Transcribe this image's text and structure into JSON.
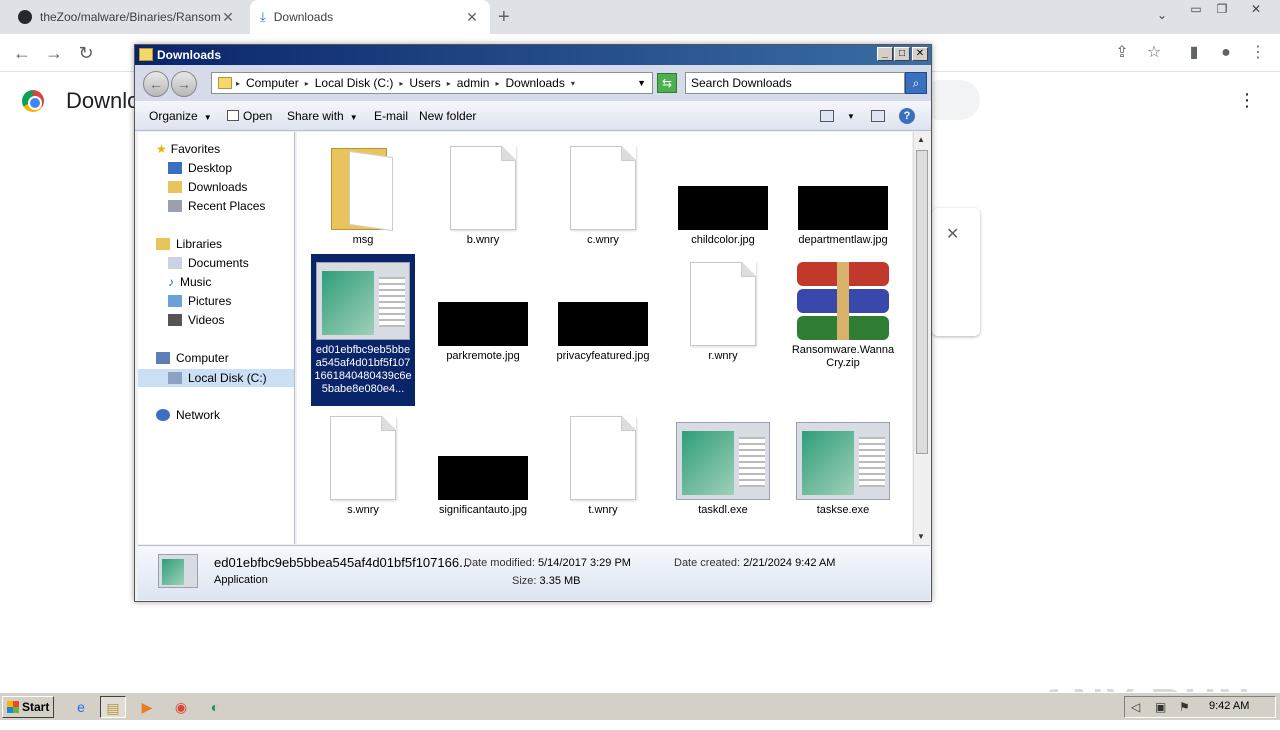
{
  "browser": {
    "tabs": [
      {
        "label": "theZoo/malware/Binaries/Ransomwa",
        "active": false
      },
      {
        "label": "Downloads",
        "active": true
      }
    ],
    "page_title": "Downloa",
    "colors": {
      "tabstrip": "#dee1e6",
      "accent": "#1a73e8"
    }
  },
  "explorer": {
    "title": "Downloads",
    "breadcrumbs": [
      "Computer",
      "Local Disk (C:)",
      "Users",
      "admin",
      "Downloads"
    ],
    "search_placeholder": "Search Downloads",
    "commands": {
      "organize": "Organize",
      "open": "Open",
      "share": "Share with",
      "email": "E-mail",
      "new_folder": "New folder"
    },
    "nav": {
      "favorites": "Favorites",
      "desktop": "Desktop",
      "downloads": "Downloads",
      "recent": "Recent Places",
      "libraries": "Libraries",
      "documents": "Documents",
      "music": "Music",
      "pictures": "Pictures",
      "videos": "Videos",
      "computer": "Computer",
      "local_disk": "Local Disk (C:)",
      "network": "Network"
    },
    "files": [
      {
        "name": "msg",
        "kind": "folder"
      },
      {
        "name": "b.wnry",
        "kind": "doc"
      },
      {
        "name": "c.wnry",
        "kind": "doc"
      },
      {
        "name": "childcolor.jpg",
        "kind": "black"
      },
      {
        "name": "departmentlaw.jpg",
        "kind": "black"
      },
      {
        "name": "ed01ebfbc9eb5bbea545af4d01bf5f1071661840480439c6e5babe8e080e4...",
        "kind": "exe",
        "selected": true
      },
      {
        "name": "parkremote.jpg",
        "kind": "black"
      },
      {
        "name": "privacyfeatured.jpg",
        "kind": "black"
      },
      {
        "name": "r.wnry",
        "kind": "doc"
      },
      {
        "name": "Ransomware.WannaCry.zip",
        "kind": "rar"
      },
      {
        "name": "s.wnry",
        "kind": "doc"
      },
      {
        "name": "significantauto.jpg",
        "kind": "black"
      },
      {
        "name": "t.wnry",
        "kind": "doc"
      },
      {
        "name": "taskdl.exe",
        "kind": "exe"
      },
      {
        "name": "taskse.exe",
        "kind": "exe"
      }
    ],
    "details": {
      "filename": "ed01ebfbc9eb5bbea545af4d01bf5f107166...",
      "type": "Application",
      "modified_label": "Date modified:",
      "modified": "5/14/2017 3:29 PM",
      "size_label": "Size:",
      "size": "3.35 MB",
      "created_label": "Date created:",
      "created": "2/21/2024 9:42 AM"
    }
  },
  "taskbar": {
    "start_label": "Start",
    "clock": "9:42 AM"
  },
  "watermark": "ANY RUN"
}
